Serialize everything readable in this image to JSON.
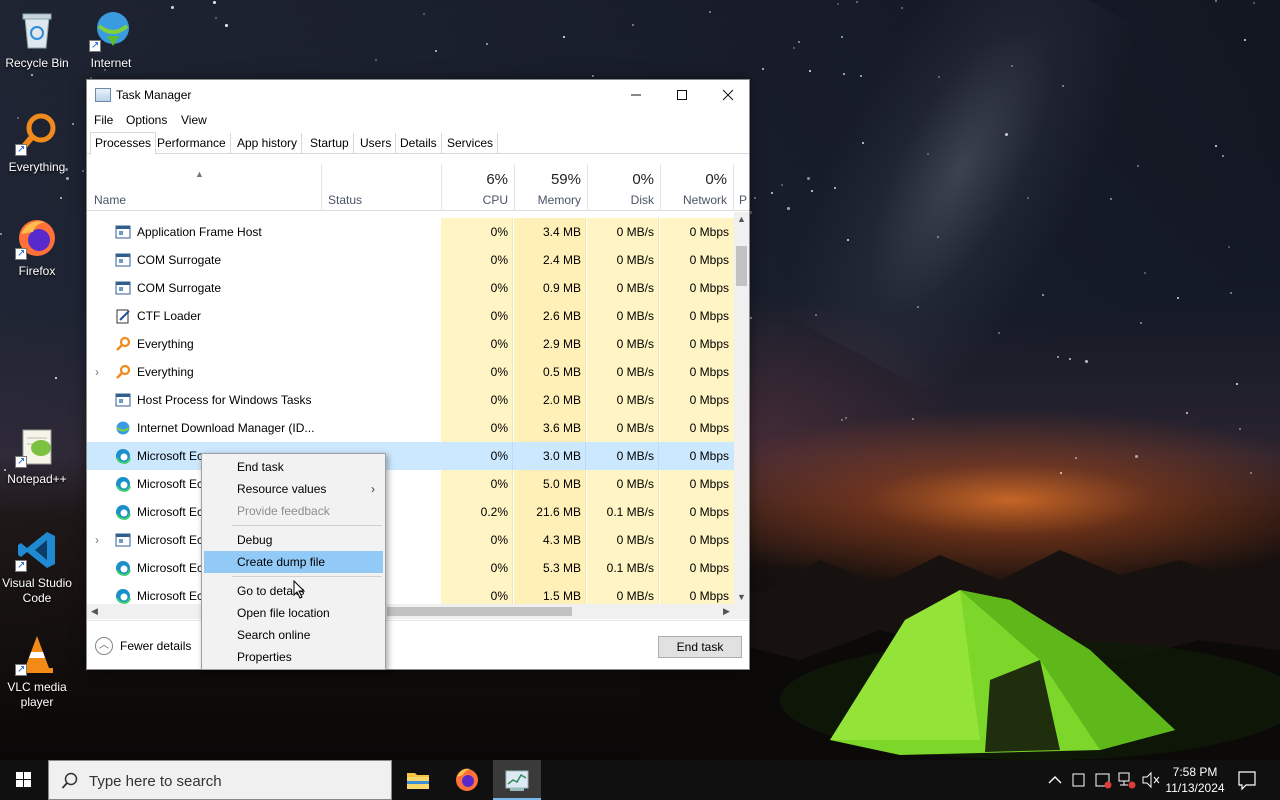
{
  "desktop": {
    "icons": [
      {
        "label": "Recycle Bin"
      },
      {
        "label": "Internet Download"
      },
      {
        "label": "Everything"
      },
      {
        "label": "Firefox"
      },
      {
        "label": "Notepad++"
      },
      {
        "label": "Visual Studio Code"
      },
      {
        "label": "VLC media player"
      }
    ]
  },
  "window": {
    "title": "Task Manager",
    "menu": [
      "File",
      "Options",
      "View"
    ],
    "tabs": [
      "Processes",
      "Performance",
      "App history",
      "Startup",
      "Users",
      "Details",
      "Services"
    ],
    "active_tab": "Processes",
    "columns": {
      "name": "Name",
      "status": "Status",
      "cpu": {
        "pct": "6%",
        "label": "CPU"
      },
      "memory": {
        "pct": "59%",
        "label": "Memory"
      },
      "disk": {
        "pct": "0%",
        "label": "Disk"
      },
      "network": {
        "pct": "0%",
        "label": "Network"
      },
      "power_partial": "P"
    },
    "rows": [
      {
        "name": "Application Frame Host",
        "icon": "app-window-icon",
        "cpu": "0%",
        "mem": "3.4 MB",
        "disk": "0 MB/s",
        "net": "0 Mbps",
        "expandable": false
      },
      {
        "name": "COM Surrogate",
        "icon": "app-window-icon",
        "cpu": "0%",
        "mem": "2.4 MB",
        "disk": "0 MB/s",
        "net": "0 Mbps",
        "expandable": false
      },
      {
        "name": "COM Surrogate",
        "icon": "app-window-icon",
        "cpu": "0%",
        "mem": "0.9 MB",
        "disk": "0 MB/s",
        "net": "0 Mbps",
        "expandable": false
      },
      {
        "name": "CTF Loader",
        "icon": "notepad-pen-icon",
        "cpu": "0%",
        "mem": "2.6 MB",
        "disk": "0 MB/s",
        "net": "0 Mbps",
        "expandable": false
      },
      {
        "name": "Everything",
        "icon": "magnifier-icon",
        "cpu": "0%",
        "mem": "2.9 MB",
        "disk": "0 MB/s",
        "net": "0 Mbps",
        "expandable": false
      },
      {
        "name": "Everything",
        "icon": "magnifier-icon",
        "cpu": "0%",
        "mem": "0.5 MB",
        "disk": "0 MB/s",
        "net": "0 Mbps",
        "expandable": true
      },
      {
        "name": "Host Process for Windows Tasks",
        "icon": "app-window-icon",
        "cpu": "0%",
        "mem": "2.0 MB",
        "disk": "0 MB/s",
        "net": "0 Mbps",
        "expandable": false
      },
      {
        "name": "Internet Download Manager (ID...",
        "icon": "globe-icon",
        "cpu": "0%",
        "mem": "3.6 MB",
        "disk": "0 MB/s",
        "net": "0 Mbps",
        "expandable": false
      },
      {
        "name": "Microsoft Ec",
        "icon": "edge-icon",
        "cpu": "0%",
        "mem": "3.0 MB",
        "disk": "0 MB/s",
        "net": "0 Mbps",
        "expandable": false,
        "selected": true
      },
      {
        "name": "Microsoft Ec",
        "icon": "edge-icon",
        "cpu": "0%",
        "mem": "5.0 MB",
        "disk": "0 MB/s",
        "net": "0 Mbps",
        "expandable": false
      },
      {
        "name": "Microsoft Ec",
        "icon": "edge-icon",
        "cpu": "0.2%",
        "mem": "21.6 MB",
        "disk": "0.1 MB/s",
        "net": "0 Mbps",
        "expandable": false
      },
      {
        "name": "Microsoft Ec",
        "icon": "app-window-icon",
        "cpu": "0%",
        "mem": "4.3 MB",
        "disk": "0 MB/s",
        "net": "0 Mbps",
        "expandable": true
      },
      {
        "name": "Microsoft Ec",
        "icon": "edge-icon",
        "cpu": "0%",
        "mem": "5.3 MB",
        "disk": "0.1 MB/s",
        "net": "0 Mbps",
        "expandable": false
      },
      {
        "name": "Microsoft Ec",
        "icon": "edge-icon",
        "cpu": "0%",
        "mem": "1.5 MB",
        "disk": "0 MB/s",
        "net": "0 Mbps",
        "expandable": false
      }
    ],
    "footer": {
      "fewer_details": "Fewer details",
      "end_task": "End task"
    }
  },
  "context_menu": {
    "items": [
      {
        "label": "End task",
        "state": "normal"
      },
      {
        "label": "Resource values",
        "state": "submenu"
      },
      {
        "label": "Provide feedback",
        "state": "disabled"
      },
      {
        "label": "Debug",
        "state": "normal"
      },
      {
        "label": "Create dump file",
        "state": "highlighted"
      },
      {
        "label": "Go to details",
        "state": "normal"
      },
      {
        "label": "Open file location",
        "state": "normal"
      },
      {
        "label": "Search online",
        "state": "normal"
      },
      {
        "label": "Properties",
        "state": "normal"
      }
    ],
    "submenu_glyph": "›"
  },
  "taskbar": {
    "search_placeholder": "Type here to search",
    "time": "7:58 PM",
    "date": "11/13/2024",
    "pinned": [
      "file-explorer-icon",
      "firefox-icon",
      "task-manager-icon"
    ],
    "active": "task-manager-icon"
  },
  "colors": {
    "selection": "#cce8ff",
    "menu_highlight": "#91c9f7",
    "heat_yellow": "#fff4c4",
    "taskbar": "#101010",
    "accent": "#76b9ed"
  }
}
